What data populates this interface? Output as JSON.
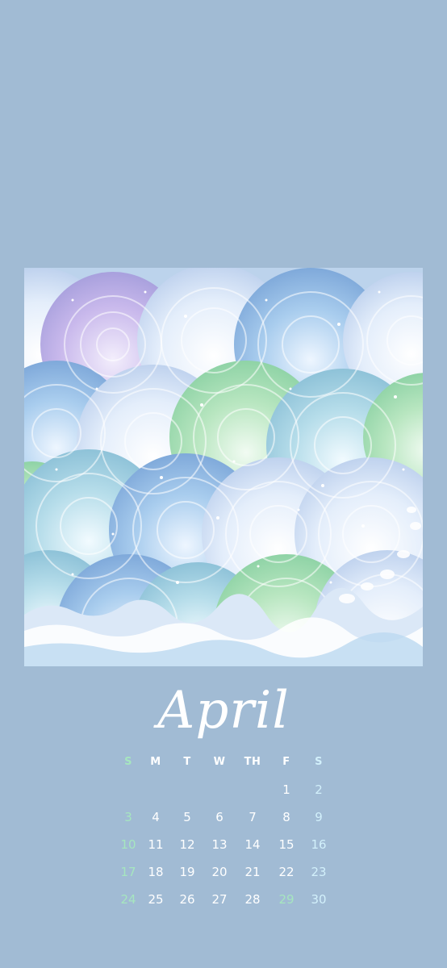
{
  "wallpaper": {
    "background_color": "#a1bbd4",
    "artwork": {
      "description_icon": "painted-waves-icon",
      "palette": [
        "#c7b8ee",
        "#a9cdee",
        "#b8e8c4",
        "#e9f4ff",
        "#ffffff"
      ]
    }
  },
  "calendar": {
    "month": "April",
    "weekday_headers": [
      "S",
      "M",
      "T",
      "W",
      "TH",
      "F",
      "S"
    ],
    "colors": {
      "sunday": "#a6e6bf",
      "saturday": "#d2f0fb",
      "weekday": "#ffffff"
    },
    "weeks": [
      [
        "",
        "",
        "",
        "",
        "",
        "1",
        "2"
      ],
      [
        "3",
        "4",
        "5",
        "6",
        "7",
        "8",
        "9"
      ],
      [
        "10",
        "11",
        "12",
        "13",
        "14",
        "15",
        "16"
      ],
      [
        "17",
        "18",
        "19",
        "20",
        "21",
        "22",
        "23"
      ],
      [
        "24",
        "25",
        "26",
        "27",
        "28",
        "29",
        "30"
      ]
    ]
  }
}
